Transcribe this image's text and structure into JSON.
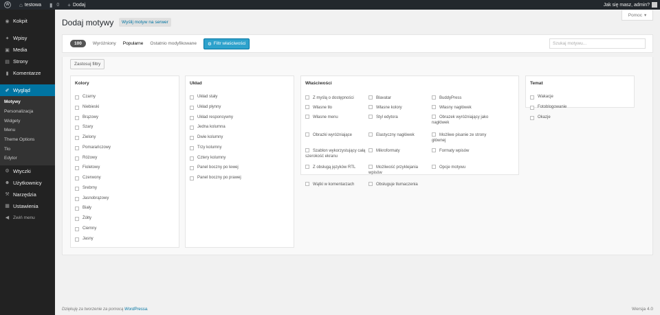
{
  "adminbar": {
    "site_name": "testowa",
    "comments_count": "0",
    "new_label": "Dodaj",
    "greeting": "Jak się masz, admin?"
  },
  "menu": {
    "dashboard": "Kokpit",
    "posts": "Wpisy",
    "media": "Media",
    "pages": "Strony",
    "comments": "Komentarze",
    "appearance": "Wygląd",
    "appearance_sub": [
      "Motywy",
      "Personalizacja",
      "Widgety",
      "Menu",
      "Theme Options",
      "Tło",
      "Edytor"
    ],
    "plugins": "Wtyczki",
    "users": "Użytkownicy",
    "tools": "Narzędzia",
    "settings": "Ustawienia",
    "collapse": "Zwiń menu"
  },
  "header": {
    "help": "Pomoc",
    "title": "Dodaj motywy",
    "upload": "Wyślij motyw na serwer"
  },
  "filter_bar": {
    "count": "100",
    "links": [
      "Wyróżniony",
      "Popularne",
      "Ostatnio modyfikowane"
    ],
    "feature_filter": "Filtr właściwości",
    "search_placeholder": "Szukaj motywu..."
  },
  "drawer": {
    "apply": "Zastosuj filtry",
    "colors": {
      "title": "Kolory",
      "items": [
        "Czarny",
        "Niebieski",
        "Brązowy",
        "Szary",
        "Zielony",
        "Pomarańczowy",
        "Różowy",
        "Fioletowy",
        "Czerwony",
        "Srebrny",
        "Jasnobrązowy",
        "Biały",
        "Żółty",
        "Ciemny",
        "Jasny"
      ]
    },
    "layout": {
      "title": "Układ",
      "items": [
        "Układ stały",
        "Układ płynny",
        "Układ responsywny",
        "Jedna kolumna",
        "Dwie kolumny",
        "Trzy kolumny",
        "Cztery kolumny",
        "Panel boczny po lewej",
        "Panel boczny po prawej"
      ]
    },
    "features": {
      "title": "Właściwości",
      "items": [
        "Z myślą o dostępności",
        "Blavatar",
        "BuddyPress",
        "Własne tło",
        "Własne kolory",
        "Własny nagłówek",
        "Własne menu",
        "Styl edytora",
        "Obrazek wyróżniający jako nagłówek",
        "Obrazki wyróżniające",
        "Elastyczny nagłówek",
        "Możliwe pisanie ze strony głównej",
        "Szablon wykorzystujący całą szerokość ekranu",
        "Mikroformaty",
        "Formaty wpisów",
        "Z obsługą języków RTL",
        "Możliwość przyklejania wpisów",
        "Opcje motywu",
        "Wątki w komentarzach",
        "Obsługuje tłumaczenia"
      ]
    },
    "subject": {
      "title": "Temat",
      "items": [
        "Wakacje",
        "Fotoblogowanie",
        "Okazje"
      ]
    }
  },
  "footer": {
    "thanks_prefix": "Dziękuję za tworzenie za pomocą ",
    "wordpress": "WordPressa",
    "thanks_suffix": ".",
    "version": "Wersja 4.0"
  }
}
